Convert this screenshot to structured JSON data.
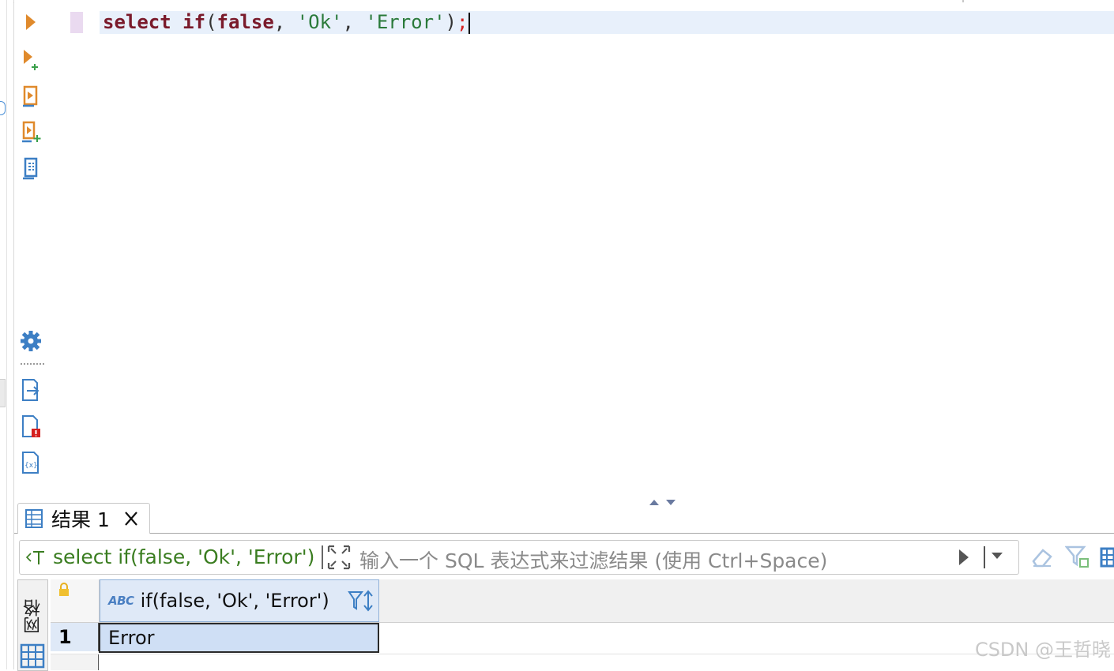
{
  "editor": {
    "sql_tokens": {
      "kw_select": "select",
      "kw_if": "if",
      "open_paren": "(",
      "kw_false": "false",
      "comma1": ", ",
      "str_ok": "'Ok'",
      "comma2": ", ",
      "str_error": "'Error'",
      "close_paren": ")",
      "semicolon": ";"
    }
  },
  "toolbar": {
    "icons": [
      "execute-statement-icon",
      "execute-in-new-tab-icon",
      "execute-script-icon",
      "execute-script-new-tab-icon",
      "explain-plan-icon",
      "settings-gear-icon",
      "export-icon",
      "problems-icon",
      "variables-icon"
    ]
  },
  "results": {
    "tab_label": "结果 1",
    "filter": {
      "sql_text": "select if(false, 'Ok', 'Error')",
      "placeholder": "输入一个 SQL 表达式来过滤结果 (使用 Ctrl+Space)"
    },
    "side_tab_label": "网格",
    "table": {
      "columns": [
        {
          "type": "ABC",
          "name": "if(false, 'Ok', 'Error')"
        }
      ],
      "rows": [
        {
          "num": "1",
          "values": [
            "Error"
          ]
        }
      ]
    }
  },
  "watermark": "CSDN @王哲晓",
  "colors": {
    "keyword": "#7a1a2b",
    "string": "#2a7a3a",
    "semicolon": "#d42020",
    "run_orange": "#e08a2c",
    "icon_blue": "#3d7fc4",
    "selection": "#cfdff5"
  }
}
